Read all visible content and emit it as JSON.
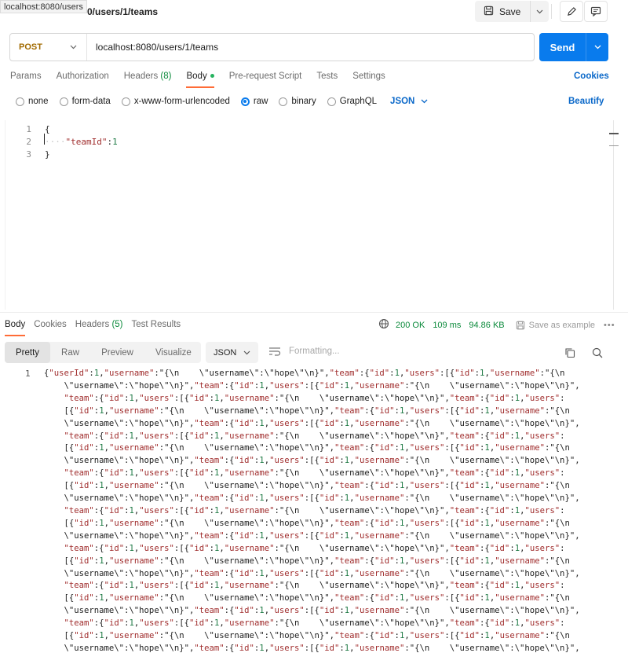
{
  "browser_tooltip": "localhost:8080/users",
  "request_name": "0/users/1/teams",
  "toolbar": {
    "save_label": "Save"
  },
  "request": {
    "method": "POST",
    "url": "localhost:8080/users/1/teams",
    "send_label": "Send"
  },
  "request_tabs": {
    "params": "Params",
    "authorization": "Authorization",
    "headers": "Headers",
    "headers_count": "(8)",
    "body": "Body",
    "pre_request": "Pre-request Script",
    "tests": "Tests",
    "settings": "Settings",
    "cookies": "Cookies"
  },
  "body_types": {
    "none": "none",
    "form_data": "form-data",
    "urlencoded": "x-www-form-urlencoded",
    "raw": "raw",
    "binary": "binary",
    "graphql": "GraphQL",
    "language": "JSON",
    "selected": "raw",
    "beautify": "Beautify"
  },
  "editor": {
    "lines": [
      {
        "n": "1",
        "text": "{"
      },
      {
        "n": "2",
        "key": "\"teamId\"",
        "sep": ":",
        "value": "1"
      },
      {
        "n": "3",
        "text": "}"
      }
    ]
  },
  "response": {
    "tabs": {
      "body": "Body",
      "cookies": "Cookies",
      "headers": "Headers",
      "headers_count": "(5)",
      "test_results": "Test Results"
    },
    "status": "200 OK",
    "time": "109 ms",
    "size": "94.86 KB",
    "save_example": "Save as example",
    "views": {
      "pretty": "Pretty",
      "raw": "Raw",
      "preview": "Preview",
      "visualize": "Visualize"
    },
    "format": "JSON",
    "formatting": "Formatting...",
    "line_number": "1",
    "first_line": "{\"userId\":1,\"username\":\"{\\n    \\\"username\\\":\\\"hope\\\"\\n}\",\"team\":{\"id\":1,\"users\":[{\"id\":1,\"username\":\"{\\n",
    "repeat_a": "    \\\"username\\\":\\\"hope\\\"\\n}\",\"team\":{\"id\":1,\"users\":[{\"id\":1,\"username\":\"{\\n    \\\"username\\\":\\\"hope\\\"\\n}\",",
    "repeat_b": "    \"team\":{\"id\":1,\"users\":[{\"id\":1,\"username\":\"{\\n    \\\"username\\\":\\\"hope\\\"\\n}\",\"team\":{\"id\":1,\"users\":",
    "repeat_c": "    [{\"id\":1,\"username\":\"{\\n    \\\"username\\\":\\\"hope\\\"\\n}\",\"team\":{\"id\":1,\"users\":[{\"id\":1,\"username\":\"{\\n"
  }
}
